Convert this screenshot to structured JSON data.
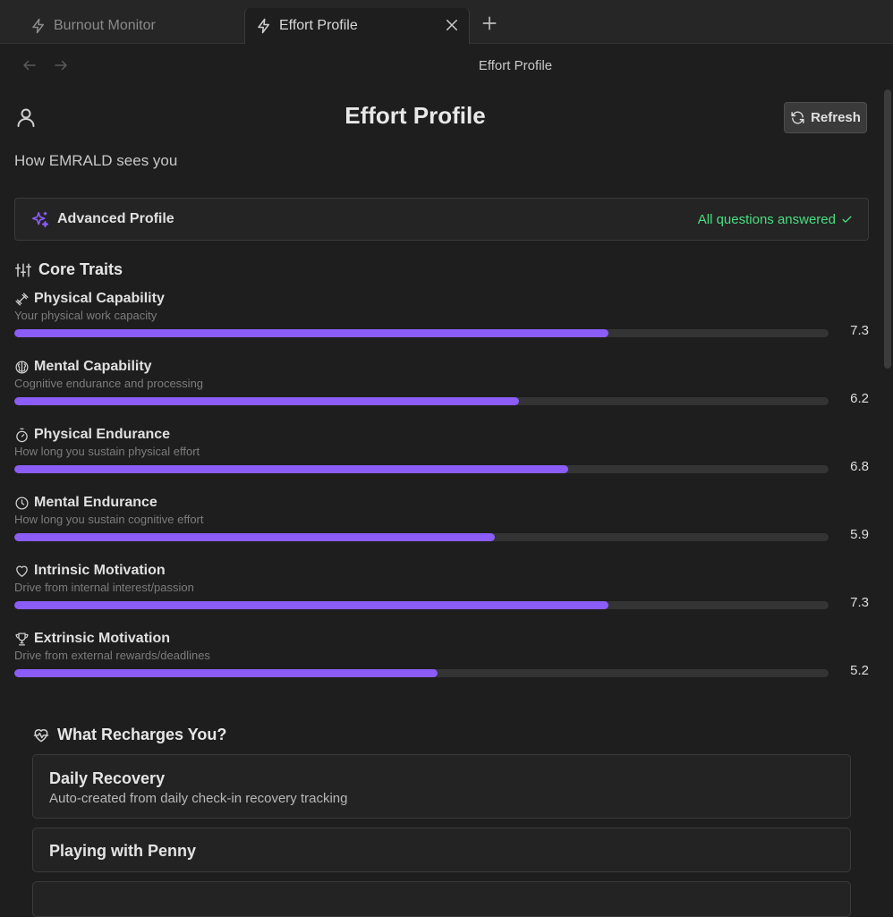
{
  "tabs": [
    {
      "label": "Burnout Monitor",
      "icon": "bolt-icon",
      "active": false
    },
    {
      "label": "Effort Profile",
      "icon": "bolt-icon",
      "active": true
    }
  ],
  "nav": {
    "title": "Effort Profile"
  },
  "header": {
    "title": "Effort Profile",
    "refresh_label": "Refresh",
    "subtitle": "How EMRALD sees you"
  },
  "advanced": {
    "title": "Advanced Profile",
    "status": "All questions answered"
  },
  "core_traits": {
    "heading": "Core Traits",
    "items": [
      {
        "name": "Physical Capability",
        "desc": "Your physical work capacity",
        "value": 7.3,
        "value_label": "7.3",
        "icon": "dumbbell-icon"
      },
      {
        "name": "Mental Capability",
        "desc": "Cognitive endurance and processing",
        "value": 6.2,
        "value_label": "6.2",
        "icon": "brain-icon"
      },
      {
        "name": "Physical Endurance",
        "desc": "How long you sustain physical effort",
        "value": 6.8,
        "value_label": "6.8",
        "icon": "timer-icon"
      },
      {
        "name": "Mental Endurance",
        "desc": "How long you sustain cognitive effort",
        "value": 5.9,
        "value_label": "5.9",
        "icon": "clock-icon"
      },
      {
        "name": "Intrinsic Motivation",
        "desc": "Drive from internal interest/passion",
        "value": 7.3,
        "value_label": "7.3",
        "icon": "heart-icon"
      },
      {
        "name": "Extrinsic Motivation",
        "desc": "Drive from external rewards/deadlines",
        "value": 5.2,
        "value_label": "5.2",
        "icon": "trophy-icon"
      }
    ]
  },
  "recharge": {
    "heading": "What Recharges You?",
    "items": [
      {
        "title": "Daily Recovery",
        "desc": "Auto-created from daily check-in recovery tracking"
      },
      {
        "title": "Playing with Penny",
        "desc": ""
      }
    ]
  },
  "colors": {
    "accent": "#8b5cf6",
    "success": "#4ade80",
    "background": "#1e1e1e"
  }
}
